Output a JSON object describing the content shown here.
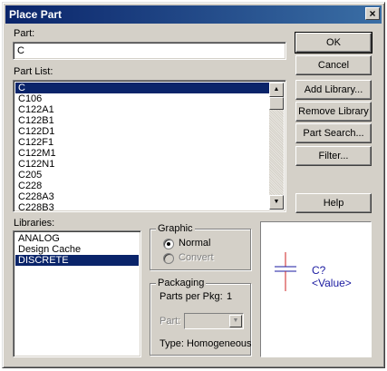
{
  "window": {
    "title": "Place Part",
    "close_glyph": "×"
  },
  "part": {
    "label": "Part:",
    "value": "C"
  },
  "part_list": {
    "label": "Part List:",
    "items": [
      "C",
      "C106",
      "C122A1",
      "C122B1",
      "C122D1",
      "C122F1",
      "C122M1",
      "C122N1",
      "C205",
      "C228",
      "C228A3",
      "C228B3"
    ],
    "selected": "C"
  },
  "libraries": {
    "label": "Libraries:",
    "items": [
      "ANALOG",
      "Design Cache",
      "DISCRETE"
    ],
    "selected": "DISCRETE"
  },
  "buttons": {
    "ok": "OK",
    "cancel": "Cancel",
    "add_library": "Add Library...",
    "remove_library": "Remove Library",
    "part_search": "Part Search...",
    "filter": "Filter...",
    "help": "Help"
  },
  "graphic": {
    "title": "Graphic",
    "normal": "Normal",
    "convert": "Convert",
    "selected": "Normal"
  },
  "packaging": {
    "title": "Packaging",
    "parts_per_pkg_label": "Parts per Pkg:",
    "parts_per_pkg_value": "1",
    "part_label": "Part:",
    "type_label": "Type:",
    "type_value": "Homogeneous"
  },
  "preview": {
    "refdes": "C?",
    "value": "<Value>",
    "symbol_color": "#cc2222",
    "text_color": "#1a1aa0"
  },
  "icons": {
    "scroll_up": "▲",
    "scroll_down": "▼",
    "dropdown": "▼"
  }
}
